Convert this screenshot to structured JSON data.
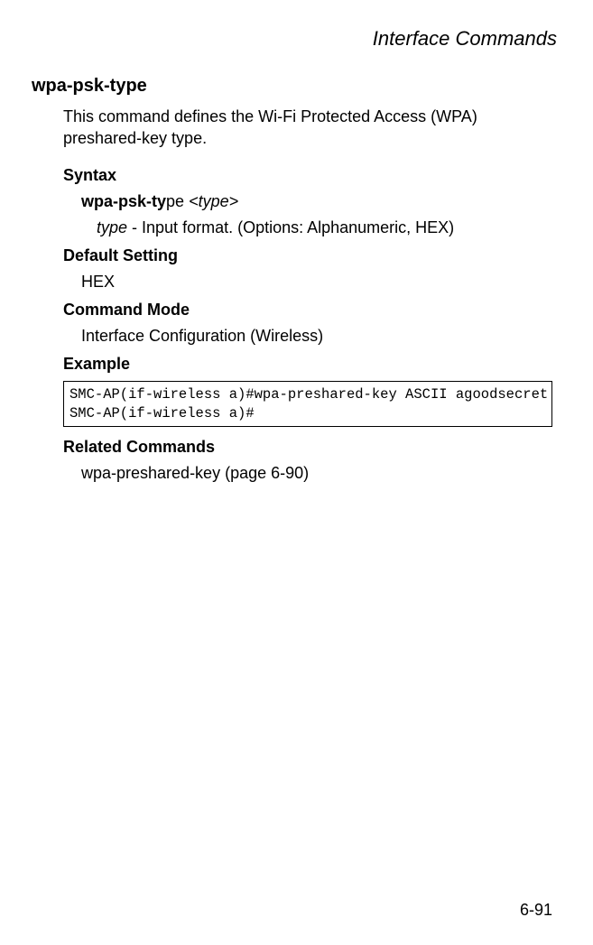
{
  "header": "Interface Commands",
  "command_name": "wpa-psk-type",
  "description": "This command defines the Wi-Fi Protected Access (WPA) preshared-key type.",
  "sections": {
    "syntax_head": "Syntax",
    "syntax_cmd_bold": "wpa-psk-ty",
    "syntax_cmd_rest": "pe ",
    "syntax_arg": "<type>",
    "param_name": "type",
    "param_desc": " - Input format. (Options: Alphanumeric, HEX)",
    "default_head": "Default Setting",
    "default_value": "HEX",
    "mode_head": "Command Mode",
    "mode_value": "Interface Configuration (Wireless)",
    "example_head": "Example",
    "example_text": "SMC-AP(if-wireless a)#wpa-preshared-key ASCII agoodsecret\nSMC-AP(if-wireless a)#",
    "related_head": "Related Commands",
    "related_value": "wpa-preshared-key (page 6-90)"
  },
  "page_number": "6-91"
}
